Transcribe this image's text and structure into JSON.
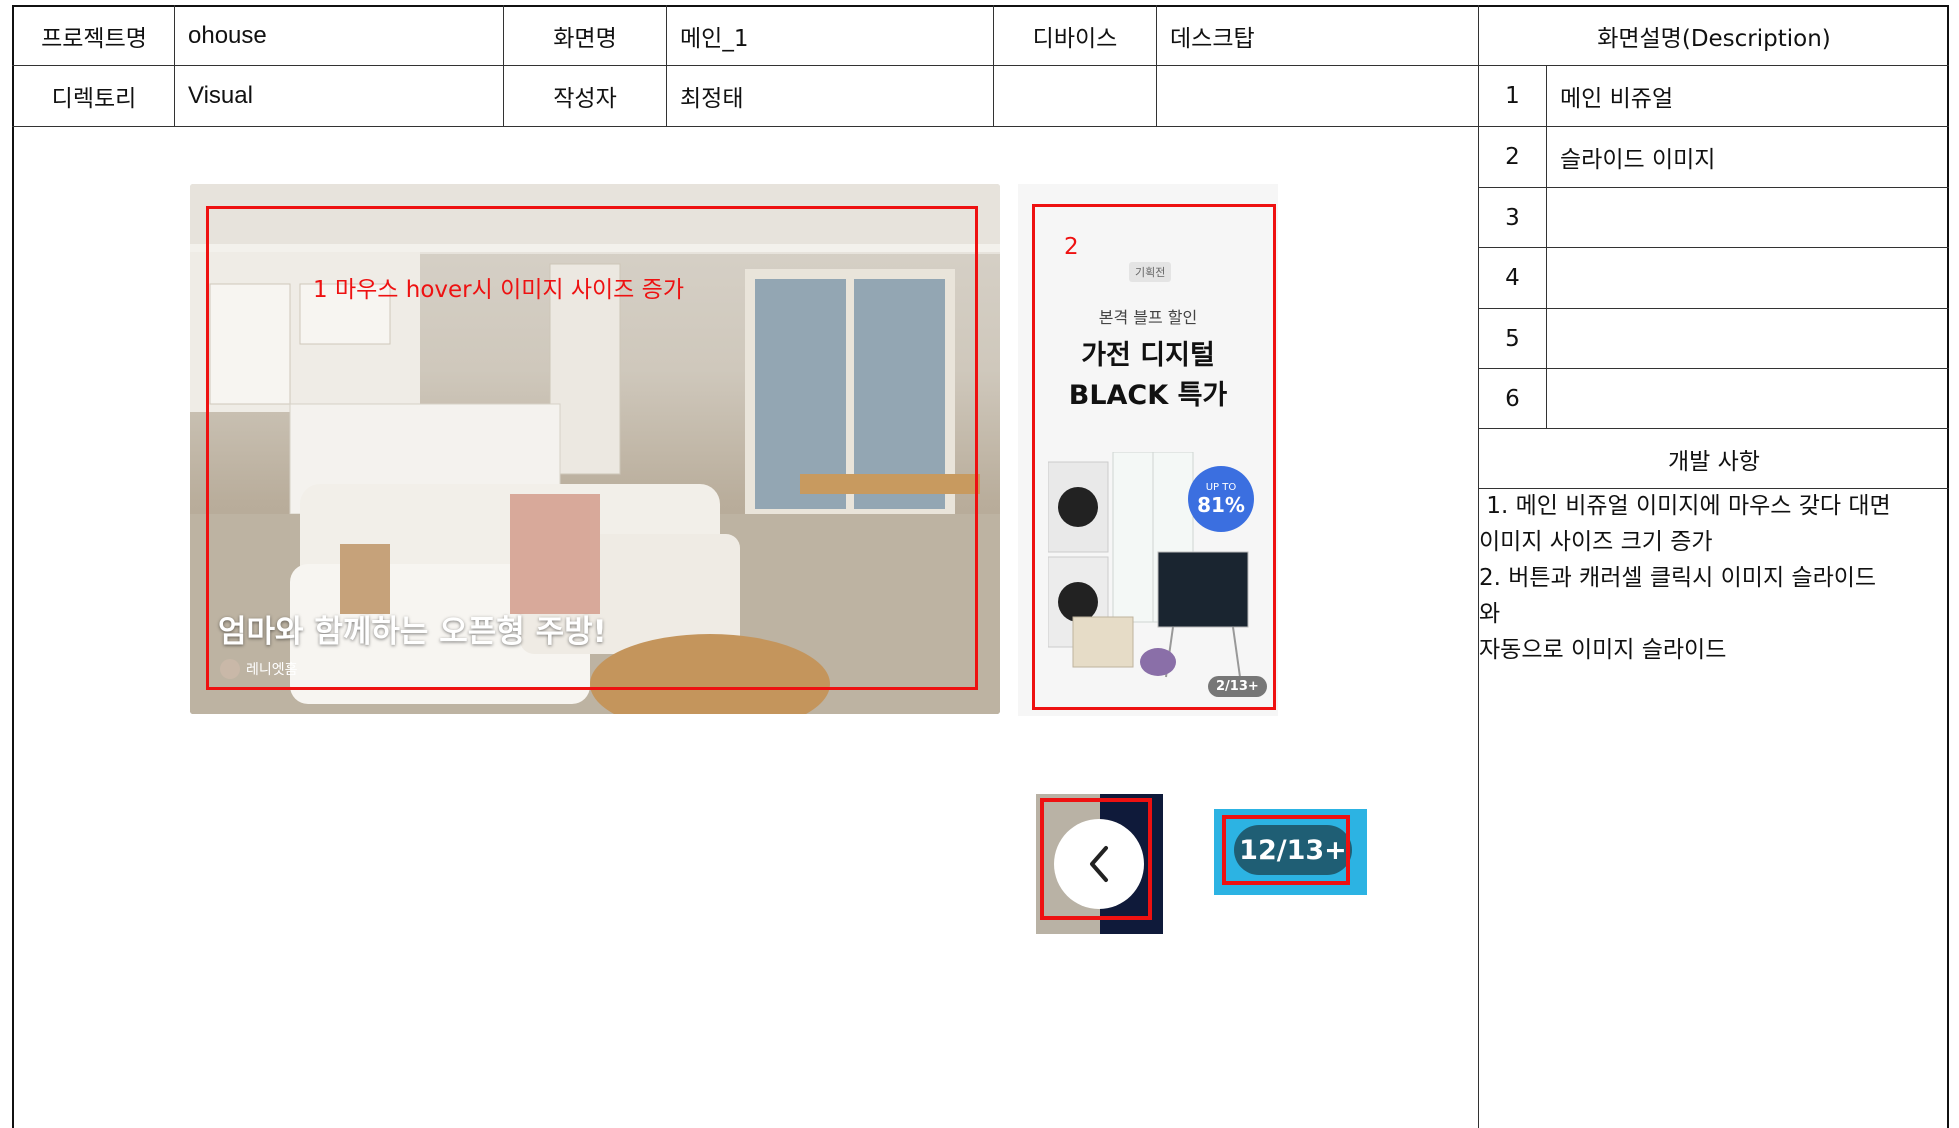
{
  "header": {
    "project_label": "프로젝트명",
    "project_value": "ohouse",
    "screen_label": "화면명",
    "screen_value": "메인_1",
    "device_label": "디바이스",
    "device_value": "데스크탑",
    "directory_label": "디렉토리",
    "directory_value": "Visual",
    "author_label": "작성자",
    "author_value": "최정태"
  },
  "description": {
    "title": "화면설명(Description)",
    "rows": [
      {
        "num": "1",
        "text": "메인 비쥬얼"
      },
      {
        "num": "2",
        "text": "슬라이드 이미지"
      },
      {
        "num": "3",
        "text": ""
      },
      {
        "num": "4",
        "text": ""
      },
      {
        "num": "5",
        "text": ""
      },
      {
        "num": "6",
        "text": ""
      }
    ]
  },
  "dev_notes": {
    "title": "개발 사항",
    "lines": [
      " 1. 메인 비쥬얼 이미지에 마우스 갖다 대면",
      "이미지 사이즈 크기 증가",
      "2. 버튼과 캐러셀 클릭시 이미지 슬라이드",
      "와",
      "자동으로 이미지 슬라이드"
    ]
  },
  "mockup": {
    "annotation_1": "1 마우스 hover시 이미지 사이즈 증가",
    "annotation_2": "2",
    "main_caption": "엄마와 함께하는 오픈형 주방!",
    "main_author": "레니엣홈",
    "banner_tag": "기획전",
    "banner_sub": "본격 블프 할인",
    "banner_title_1": "가전 디지털",
    "banner_title_2": "BLACK 특가",
    "banner_badge_top": "UP TO",
    "banner_badge_value": "81%",
    "banner_counter": "2/13+",
    "counter_large": "12/13+"
  },
  "colors": {
    "annotation_red": "#e11111",
    "badge_blue": "#3b6fe0",
    "counter_bg": "#2cb3e3",
    "counter_pill": "#1f5e74",
    "nav_dark": "#0f1a3a"
  },
  "icons": [
    "chevron-left-icon",
    "plus-icon",
    "washer-icon",
    "fridge-icon",
    "tv-icon"
  ]
}
